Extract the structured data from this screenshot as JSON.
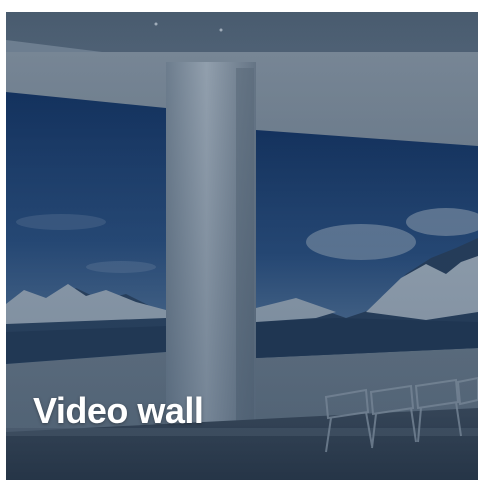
{
  "tile": {
    "title": "Video wall"
  },
  "colors": {
    "overlay": "#1f3650",
    "title_text": "#ffffff"
  }
}
